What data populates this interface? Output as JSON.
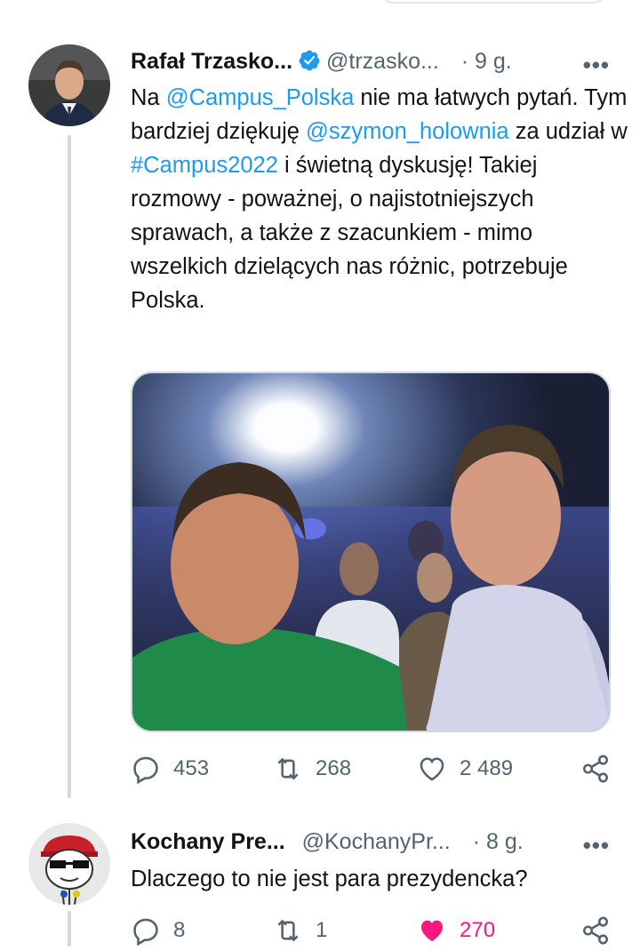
{
  "tweets": [
    {
      "author_name": "Rafał Trzasko...",
      "handle": "@trzasko...",
      "time": "· 9 g.",
      "more": "•••",
      "text_segments": [
        {
          "t": "Na ",
          "link": false
        },
        {
          "t": "@Campus_Polska",
          "link": true
        },
        {
          "t": " nie ma łatwych pytań. Tym bardziej dziękuję ",
          "link": false
        },
        {
          "t": "@szymon_holownia",
          "link": true
        },
        {
          "t": " za udział w ",
          "link": false
        },
        {
          "t": "#Campus2022",
          "link": true
        },
        {
          "t": " i świetną dyskusję! Takiej rozmowy - poważnej, o najistotniejszych sprawach, a także z szacunkiem - mimo wszelkich dzielących nas różnic, potrzebuje Polska.",
          "link": false
        }
      ],
      "verified": true,
      "has_media": true,
      "stats": {
        "replies": "453",
        "retweets": "268",
        "likes": "2 489"
      },
      "liked": false
    },
    {
      "author_name": "Kochany Pre...",
      "handle": "@KochanyPr...",
      "time": "· 8 g.",
      "more": "•••",
      "text": "Dlaczego to nie jest para prezydencka?",
      "verified": false,
      "stats": {
        "replies": "8",
        "retweets": "1",
        "likes": "270"
      },
      "liked": true
    }
  ],
  "icons": {
    "reply": "reply-icon",
    "retweet": "retweet-icon",
    "like": "heart-icon",
    "share": "share-icon",
    "verified": "verified-badge-icon"
  },
  "colors": {
    "link": "#1d9bf0",
    "secondary_text": "#536471",
    "like_active": "#f91880",
    "verified": "#1d9bf0"
  }
}
